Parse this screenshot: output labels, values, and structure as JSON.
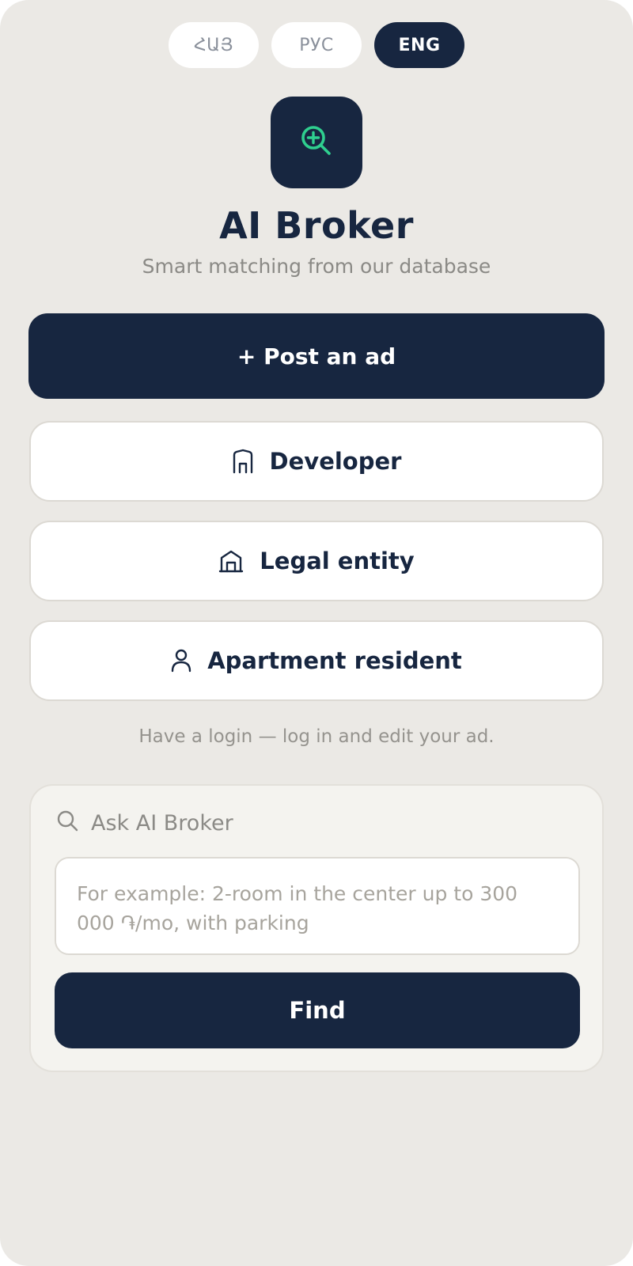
{
  "language_switch": {
    "options": [
      "ՀԱՅ",
      "РУС",
      "ENG"
    ],
    "active": "ENG"
  },
  "logo": {
    "icon": "search-plus-icon",
    "accent_color": "#2fcf8f",
    "tile_color": "#172640"
  },
  "header": {
    "title": "AI Broker",
    "subtitle": "Smart matching from our database"
  },
  "actions": {
    "post_ad_label": "+ Post an ad",
    "roles": [
      {
        "label": "Developer",
        "icon": "building-icon"
      },
      {
        "label": "Legal entity",
        "icon": "office-icon"
      },
      {
        "label": "Apartment resident",
        "icon": "user-icon"
      }
    ]
  },
  "login_hint": "Have a login — log in and edit your ad.",
  "ask": {
    "heading": "Ask AI Broker",
    "heading_icon": "search-icon",
    "input_value": "",
    "input_placeholder": "For example: 2-room in the center up to 300 000 ֏/mo, with parking",
    "submit_label": "Find"
  },
  "colors": {
    "background": "#ebe9e5",
    "primary": "#172640",
    "muted_text": "#8b8a86"
  }
}
